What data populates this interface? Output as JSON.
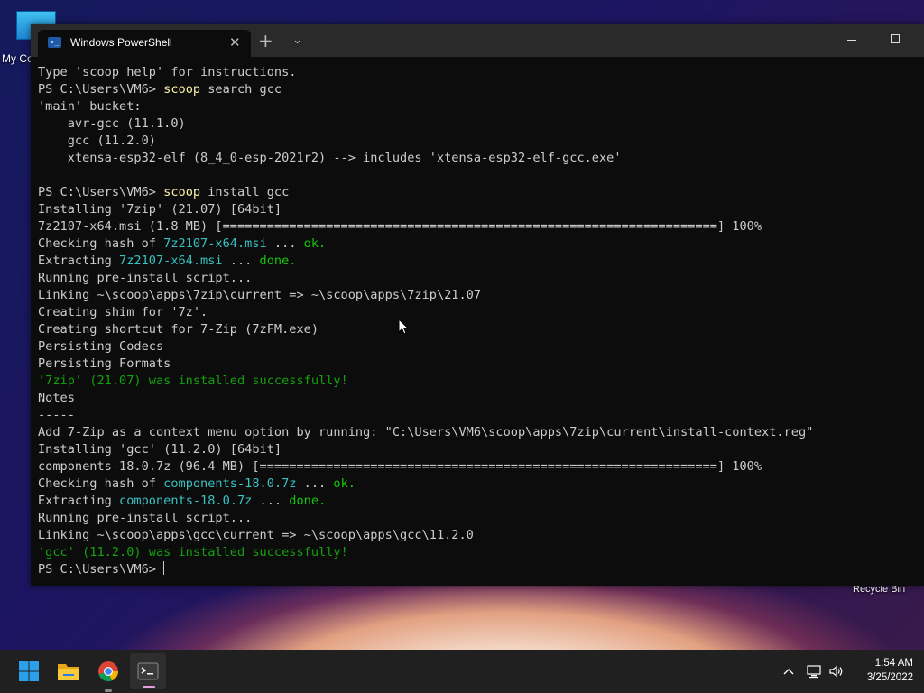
{
  "desktop": {
    "my_computer_label": "My Co",
    "recycle_bin_label": "Recycle Bin"
  },
  "window": {
    "tab_title": "Windows PowerShell",
    "tab_icon_text": ">_",
    "close_glyph": "✕",
    "new_tab_glyph": "+",
    "dropdown_glyph": "⌄"
  },
  "terminal": {
    "lines": [
      [
        {
          "t": "Type 'scoop help' for instructions.",
          "c": ""
        }
      ],
      [
        {
          "t": "PS C:\\Users\\VM6> ",
          "c": ""
        },
        {
          "t": "scoop",
          "c": "c-cmd"
        },
        {
          "t": " search gcc",
          "c": ""
        }
      ],
      [
        {
          "t": "'main' bucket:",
          "c": ""
        }
      ],
      [
        {
          "t": "    avr-gcc (11.1.0)",
          "c": ""
        }
      ],
      [
        {
          "t": "    gcc (11.2.0)",
          "c": ""
        }
      ],
      [
        {
          "t": "    xtensa-esp32-elf (8_4_0-esp-2021r2) --> includes 'xtensa-esp32-elf-gcc.exe'",
          "c": ""
        }
      ],
      [
        {
          "t": "",
          "c": ""
        }
      ],
      [
        {
          "t": "PS C:\\Users\\VM6> ",
          "c": ""
        },
        {
          "t": "scoop",
          "c": "c-cmd"
        },
        {
          "t": " install gcc",
          "c": ""
        }
      ],
      [
        {
          "t": "Installing '7zip' (21.07) [64bit]",
          "c": ""
        }
      ],
      [
        {
          "t": "7z2107-x64.msi (1.8 MB) [===================================================================] 100%",
          "c": ""
        }
      ],
      [
        {
          "t": "Checking hash of ",
          "c": ""
        },
        {
          "t": "7z2107-x64.msi",
          "c": "c-file"
        },
        {
          "t": " ... ",
          "c": ""
        },
        {
          "t": "ok.",
          "c": "c-ok"
        }
      ],
      [
        {
          "t": "Extracting ",
          "c": ""
        },
        {
          "t": "7z2107-x64.msi",
          "c": "c-file"
        },
        {
          "t": " ... ",
          "c": ""
        },
        {
          "t": "done.",
          "c": "c-ok"
        }
      ],
      [
        {
          "t": "Running pre-install script...",
          "c": ""
        }
      ],
      [
        {
          "t": "Linking ~\\scoop\\apps\\7zip\\current => ~\\scoop\\apps\\7zip\\21.07",
          "c": ""
        }
      ],
      [
        {
          "t": "Creating shim for '7z'.",
          "c": ""
        }
      ],
      [
        {
          "t": "Creating shortcut for 7-Zip (7zFM.exe)",
          "c": ""
        }
      ],
      [
        {
          "t": "Persisting Codecs",
          "c": ""
        }
      ],
      [
        {
          "t": "Persisting Formats",
          "c": ""
        }
      ],
      [
        {
          "t": "'7zip' (21.07) was installed successfully!",
          "c": "c-green"
        }
      ],
      [
        {
          "t": "Notes",
          "c": ""
        }
      ],
      [
        {
          "t": "-----",
          "c": ""
        }
      ],
      [
        {
          "t": "Add 7-Zip as a context menu option by running: \"C:\\Users\\VM6\\scoop\\apps\\7zip\\current\\install-context.reg\"",
          "c": ""
        }
      ],
      [
        {
          "t": "Installing 'gcc' (11.2.0) [64bit]",
          "c": ""
        }
      ],
      [
        {
          "t": "components-18.0.7z (96.4 MB) [==============================================================] 100%",
          "c": ""
        }
      ],
      [
        {
          "t": "Checking hash of ",
          "c": ""
        },
        {
          "t": "components-18.0.7z",
          "c": "c-file"
        },
        {
          "t": " ... ",
          "c": ""
        },
        {
          "t": "ok.",
          "c": "c-ok"
        }
      ],
      [
        {
          "t": "Extracting ",
          "c": ""
        },
        {
          "t": "components-18.0.7z",
          "c": "c-file"
        },
        {
          "t": " ... ",
          "c": ""
        },
        {
          "t": "done.",
          "c": "c-ok"
        }
      ],
      [
        {
          "t": "Running pre-install script...",
          "c": ""
        }
      ],
      [
        {
          "t": "Linking ~\\scoop\\apps\\gcc\\current => ~\\scoop\\apps\\gcc\\11.2.0",
          "c": ""
        }
      ],
      [
        {
          "t": "'gcc' (11.2.0) was installed successfully!",
          "c": "c-green"
        }
      ]
    ],
    "prompt": "PS C:\\Users\\VM6> "
  },
  "taskbar": {
    "clock_time": "1:54 AM",
    "clock_date": "3/25/2022",
    "apps": [
      "start-icon",
      "file-explorer-icon",
      "chrome-icon",
      "terminal-icon"
    ]
  },
  "colors": {
    "command": "#f9f1a5",
    "filename": "#3ac1c1",
    "ok": "#16c60c",
    "success": "#13a10e",
    "terminal_bg": "#0c0c0c"
  }
}
